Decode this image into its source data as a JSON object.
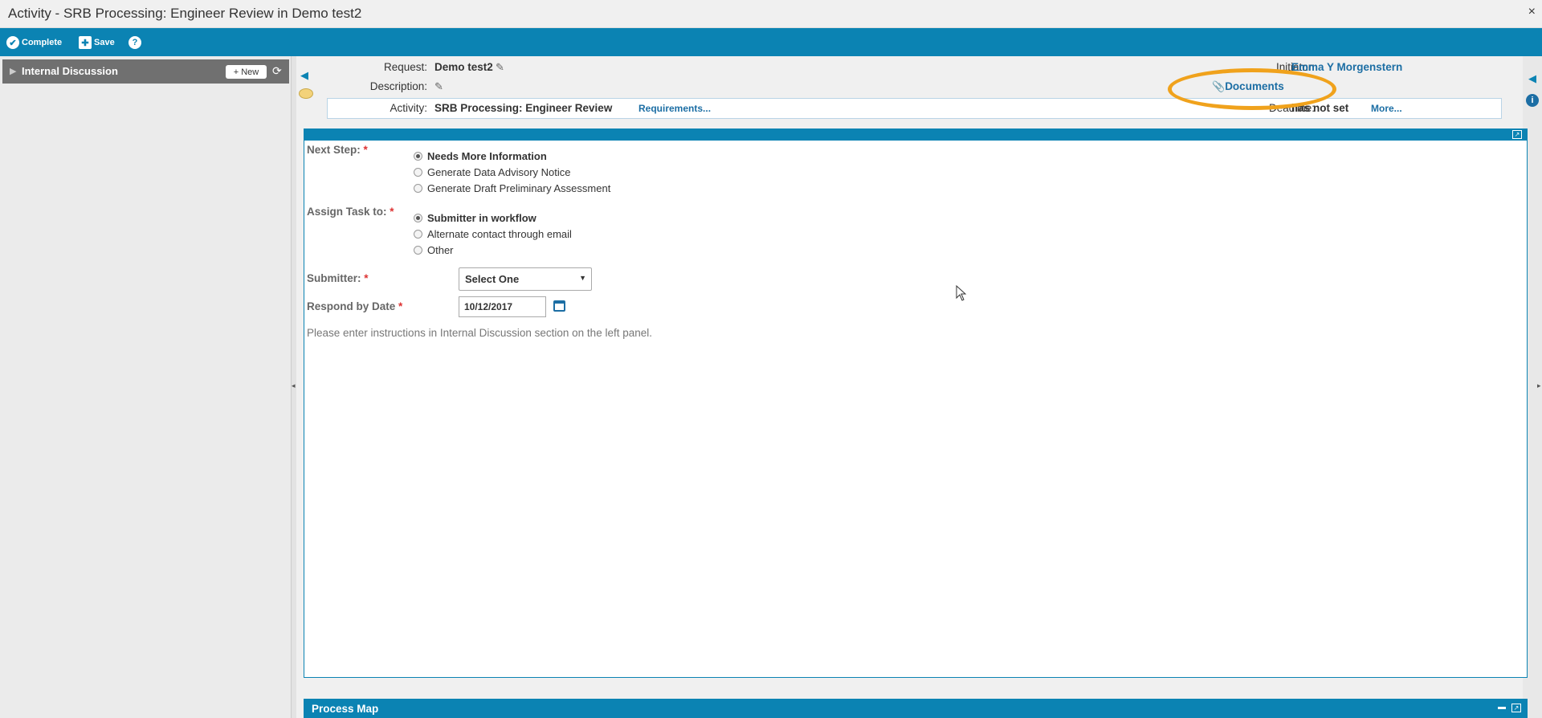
{
  "window": {
    "title": "Activity - SRB Processing: Engineer Review in Demo test2",
    "close": "×"
  },
  "toolbar": {
    "complete_label": "Complete",
    "save_label": "Save",
    "help_label": "?"
  },
  "sidebar": {
    "section_label": "Internal Discussion",
    "new_label": "+ New"
  },
  "header": {
    "request_label": "Request:",
    "request_value": "Demo test2",
    "description_label": "Description:",
    "activity_label": "Activity:",
    "activity_value": "SRB Processing: Engineer Review",
    "requirements_link": "Requirements...",
    "initiator_label": "Initiator:",
    "initiator_value": "Emma Y Morgenstern",
    "documents_link": "Documents",
    "deadline_label": "Deadline:",
    "deadline_value": "has not set",
    "more_link": "More..."
  },
  "form": {
    "next_step_label": "Next Step:",
    "next_step_options": [
      "Needs More Information",
      "Generate Data Advisory Notice",
      "Generate Draft Preliminary Assessment"
    ],
    "next_step_selected": 0,
    "assign_label": "Assign Task to:",
    "assign_options": [
      "Submitter in workflow",
      "Alternate contact through email",
      "Other"
    ],
    "assign_selected": 0,
    "submitter_label": "Submitter:",
    "submitter_value": "Select One",
    "respond_label": "Respond by Date",
    "respond_value": "10/12/2017",
    "hint": "Please enter instructions in Internal Discussion section on the left panel.",
    "required_mark": "*"
  },
  "process_map": {
    "label": "Process Map"
  },
  "colors": {
    "accent": "#0b83b3",
    "link": "#1c6ea4",
    "highlight": "#f0a21c",
    "required": "#dd3333"
  }
}
